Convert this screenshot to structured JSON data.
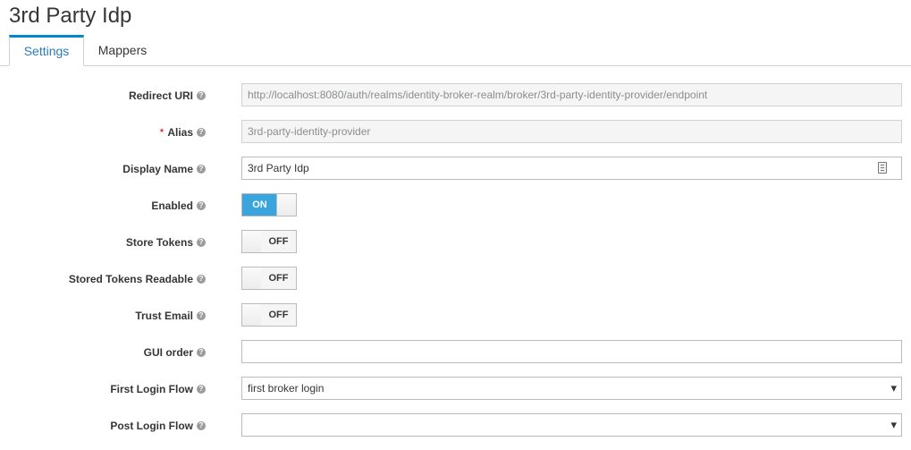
{
  "page": {
    "title": "3rd Party Idp"
  },
  "tabs": [
    {
      "label": "Settings",
      "active": true
    },
    {
      "label": "Mappers",
      "active": false
    }
  ],
  "form": {
    "redirect_uri": {
      "label": "Redirect URI",
      "value": "http://localhost:8080/auth/realms/identity-broker-realm/broker/3rd-party-identity-provider/endpoint"
    },
    "alias": {
      "label": "Alias",
      "required_mark": "*",
      "value": "3rd-party-identity-provider"
    },
    "display_name": {
      "label": "Display Name",
      "value": "3rd Party Idp"
    },
    "enabled": {
      "label": "Enabled",
      "state": "ON"
    },
    "store_tokens": {
      "label": "Store Tokens",
      "state": "OFF"
    },
    "stored_tokens_readable": {
      "label": "Stored Tokens Readable",
      "state": "OFF"
    },
    "trust_email": {
      "label": "Trust Email",
      "state": "OFF"
    },
    "gui_order": {
      "label": "GUI order",
      "value": ""
    },
    "first_login_flow": {
      "label": "First Login Flow",
      "value": "first broker login"
    },
    "post_login_flow": {
      "label": "Post Login Flow",
      "value": ""
    }
  },
  "help_glyph": "?",
  "colors": {
    "accent": "#0088ce",
    "switch_on": "#39a5dc",
    "required": "#cc0000"
  }
}
